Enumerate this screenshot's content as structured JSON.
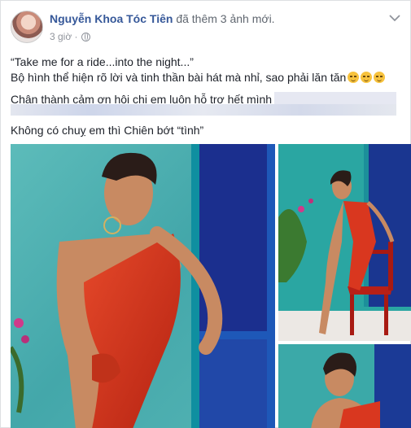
{
  "post": {
    "author": "Nguyễn Khoa Tóc Tiên",
    "action": "đã thêm 3 ảnh mới.",
    "timestamp": "3 giờ ·",
    "privacy_icon": "globe-icon",
    "menu_icon": "chevron-down-icon",
    "lines": [
      "“Take me for a ride...into the night...”",
      "Bộ hình thể hiện rõ lời và tinh thần bài hát mà nhỉ, sao phải lăn tăn"
    ],
    "line3": "Chân thành cảm ơn hội chị em luôn hỗ trợ hết mình",
    "line4": "Không có chuỵ em thì Chiên bớt “tình”",
    "emoji": "smirk-emoji",
    "colors": {
      "link": "#365899",
      "meta": "#90949c",
      "dress": "#d9371f",
      "wall": "#4fb2b3",
      "door": "#1f3e9c"
    }
  }
}
